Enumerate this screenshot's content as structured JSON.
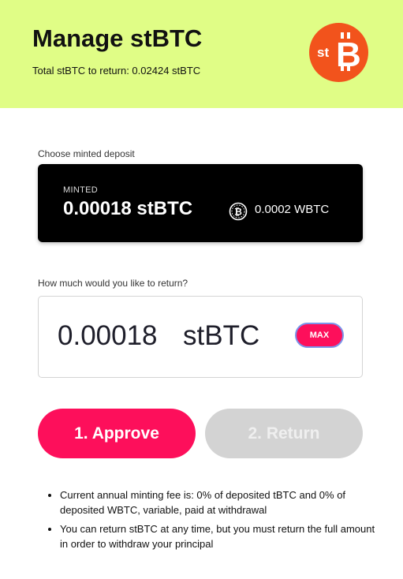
{
  "header": {
    "title": "Manage stBTC",
    "subtitle": "Total stBTC to return: 0.02424 stBTC",
    "logo_text": "st",
    "accent_color": "#e0fd86",
    "logo_color": "#f2531c"
  },
  "deposit": {
    "label": "Choose minted deposit",
    "tag": "MINTED",
    "amount": "0.00018 stBTC",
    "collateral_icon": "bitcoin-icon",
    "collateral": "0.0002 WBTC"
  },
  "return_amount": {
    "label": "How much would you like to return?",
    "value": "0.00018",
    "unit": "stBTC",
    "max_label": "MAX"
  },
  "actions": {
    "approve_label": "1. Approve",
    "return_label": "2. Return",
    "primary_color": "#fd0f5b"
  },
  "notes": [
    "Current annual minting fee is: 0% of deposited tBTC and 0% of deposited WBTC, variable, paid at withdrawal",
    "You can return stBTC at any time, but you must return the full amount in order to withdraw your principal"
  ]
}
